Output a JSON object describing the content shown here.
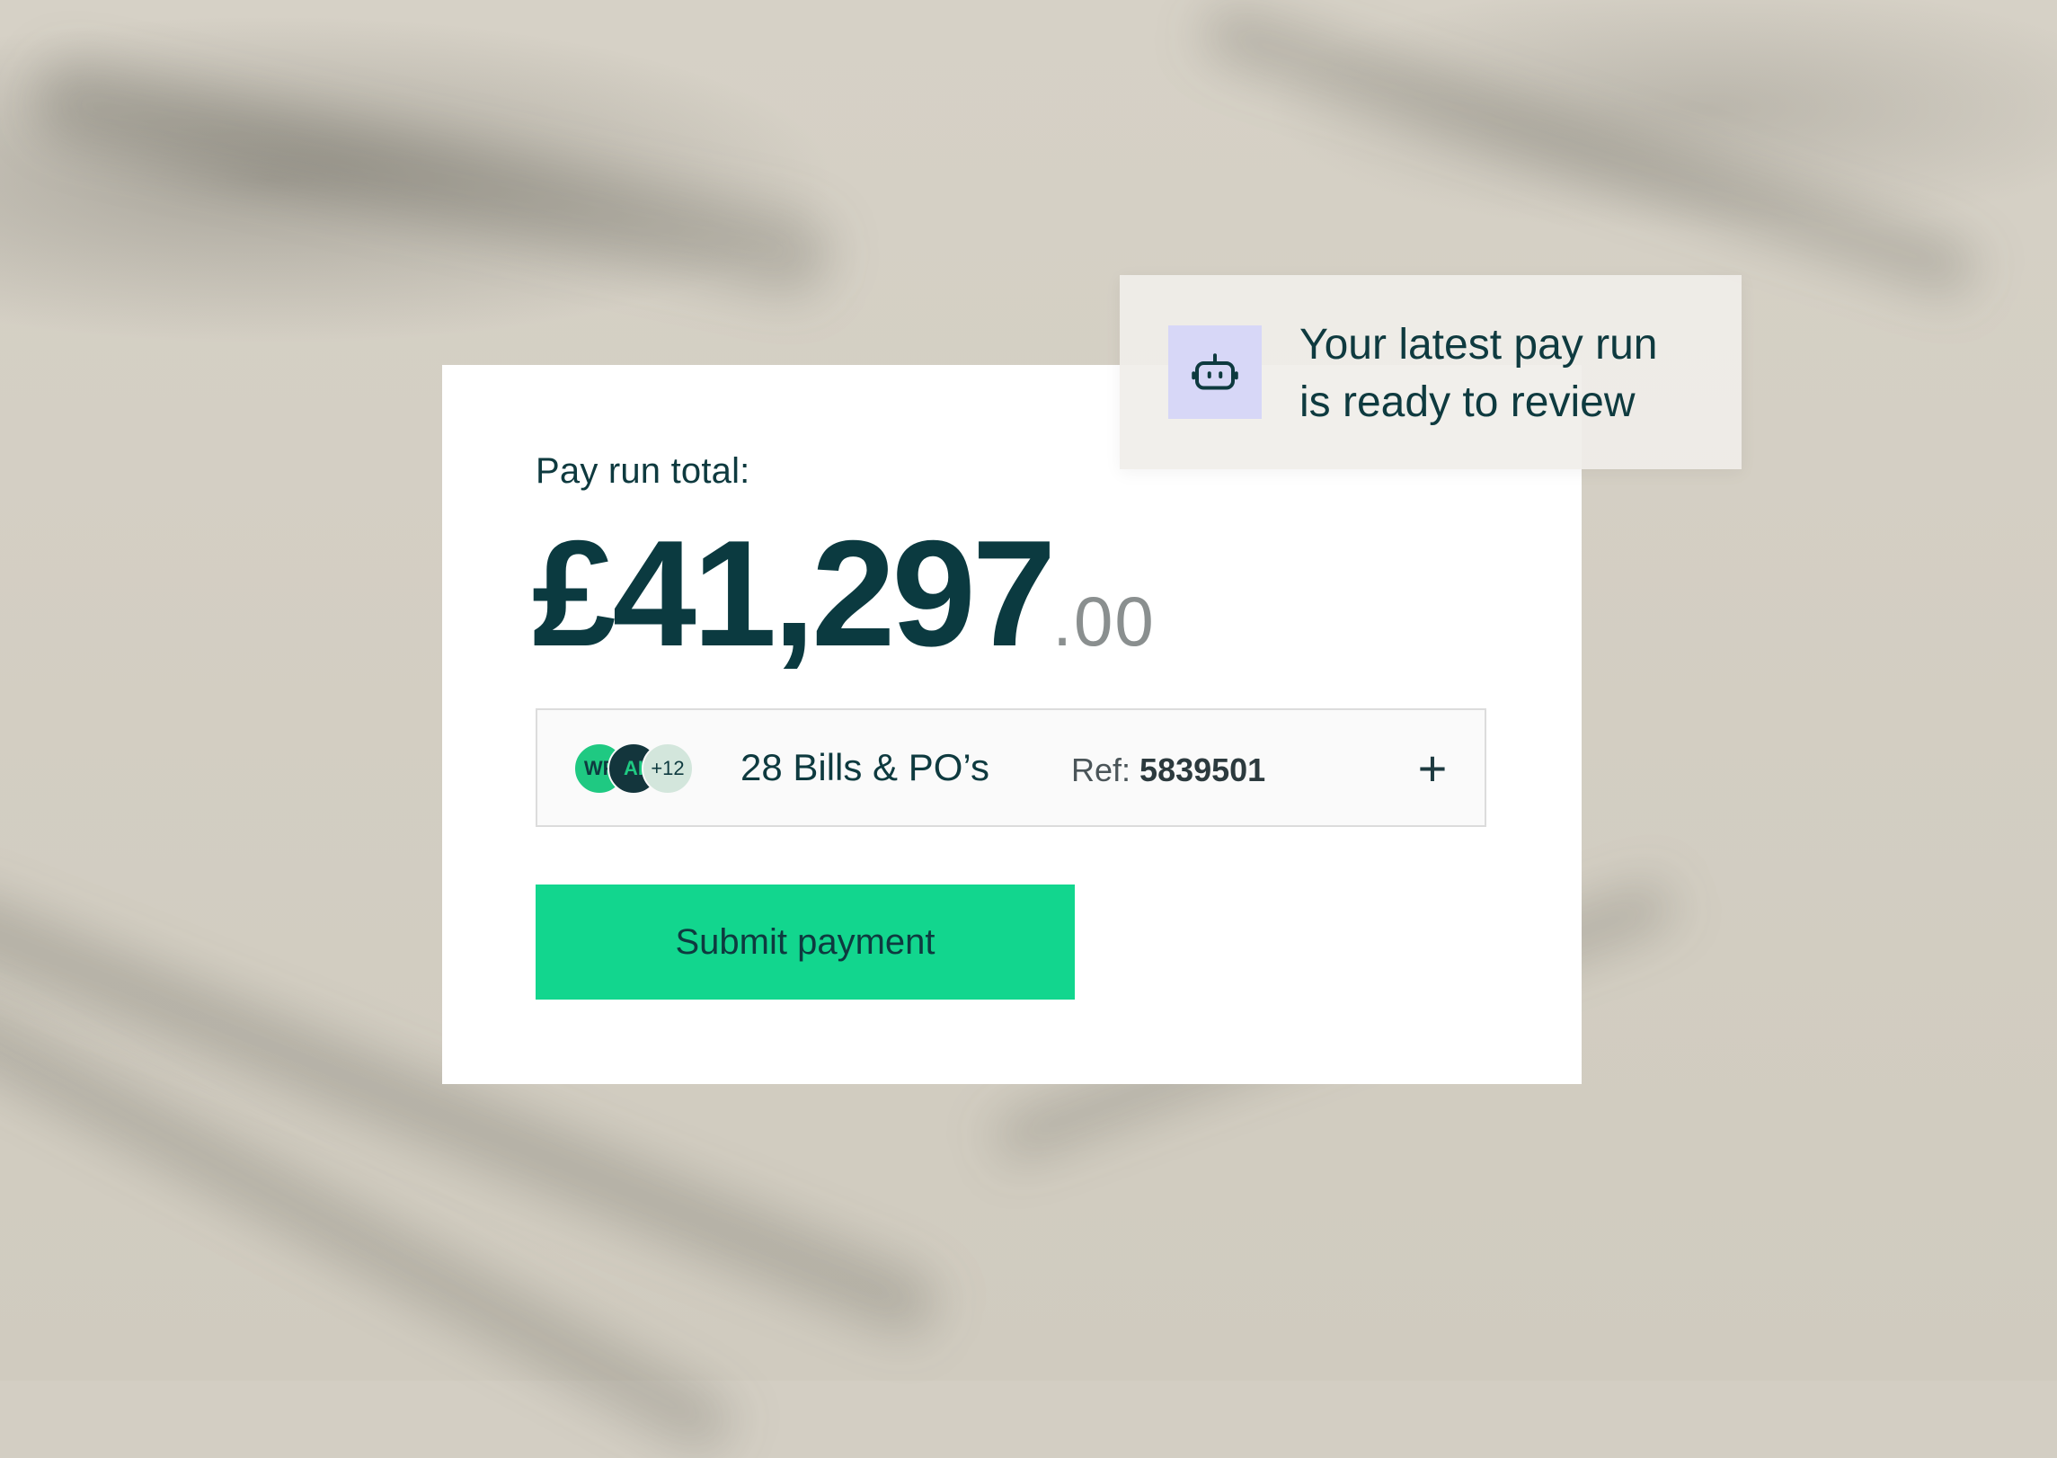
{
  "card": {
    "label": "Pay run total:",
    "amount_main": "£41,297",
    "amount_cents": ".00"
  },
  "bills": {
    "avatars": [
      "WF",
      "AI",
      "+12"
    ],
    "summary": "28 Bills & PO’s",
    "ref_label": "Ref:",
    "ref_value": "5839501",
    "expand_symbol": "+"
  },
  "actions": {
    "submit_label": "Submit payment"
  },
  "toast": {
    "icon": "robot-icon",
    "line1": "Your latest pay run",
    "line2": "is ready to review"
  },
  "colors": {
    "accent": "#12d68e",
    "text_dark": "#0b3a40",
    "bot_bg": "#d7d7f7"
  }
}
